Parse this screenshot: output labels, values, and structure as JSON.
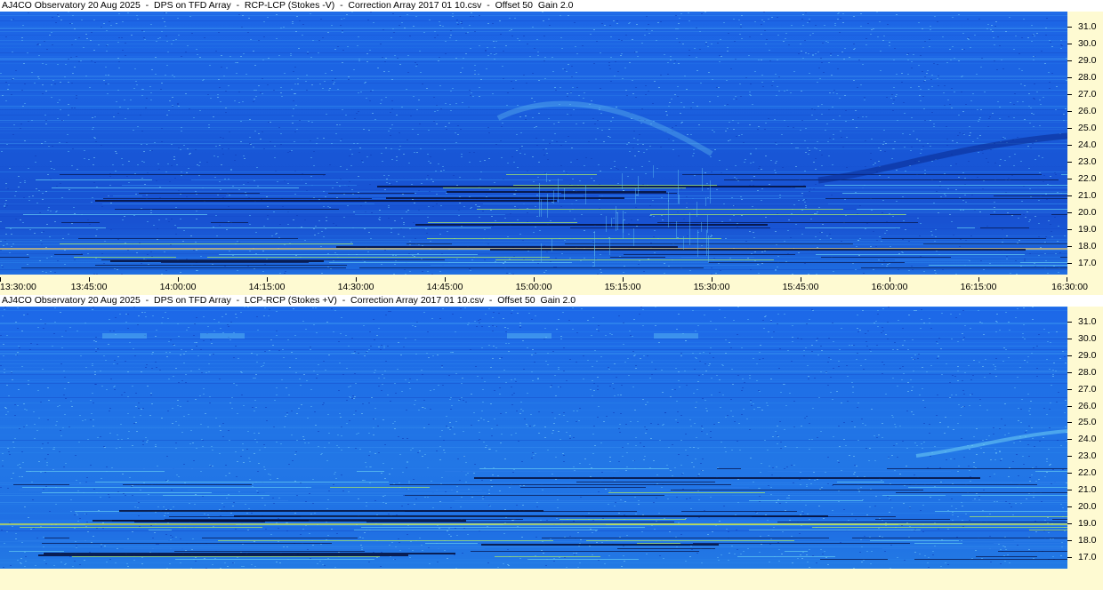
{
  "panels": [
    {
      "title": "AJ4CO Observatory 20 Aug 2025  -  DPS on TFD Array  -  RCP-LCP (Stokes -V)  -  Correction Array 2017 01 10.csv  -  Offset 50  Gain 2.0"
    },
    {
      "title": "AJ4CO Observatory 20 Aug 2025  -  DPS on TFD Array  -  LCP-RCP (Stokes +V)  -  Correction Array 2017 01 10.csv  -  Offset 50  Gain 2.0"
    }
  ],
  "colors": {
    "background": "#1a5ee0",
    "axis_bg": "#fefad2"
  },
  "chart_data": [
    {
      "type": "heatmap",
      "title": "AJ4CO Observatory 20 Aug 2025  -  DPS on TFD Array  -  RCP-LCP (Stokes -V)  -  Correction Array 2017 01 10.csv  -  Offset 50  Gain 2.0",
      "xlabel": "",
      "ylabel": "",
      "x_ticks": [
        "13:30:00",
        "13:45:00",
        "14:00:00",
        "14:15:00",
        "14:30:00",
        "14:45:00",
        "15:00:00",
        "15:15:00",
        "15:30:00",
        "15:45:00",
        "16:00:00",
        "16:15:00",
        "16:30:00"
      ],
      "y_ticks": [
        "31.0",
        "30.0",
        "29.0",
        "28.0",
        "27.0",
        "26.0",
        "25.0",
        "24.0",
        "23.0",
        "22.0",
        "21.0",
        "20.0",
        "19.0",
        "18.0",
        "17.0"
      ],
      "xlim": [
        "13:30:00",
        "16:30:00"
      ],
      "ylim": [
        16.3,
        31.9
      ],
      "colormap": "blue"
    },
    {
      "type": "heatmap",
      "title": "AJ4CO Observatory 20 Aug 2025  -  DPS on TFD Array  -  LCP-RCP (Stokes +V)  -  Correction Array 2017 01 10.csv  -  Offset 50  Gain 2.0",
      "xlabel": "",
      "ylabel": "",
      "x_ticks": [],
      "y_ticks": [
        "31.0",
        "30.0",
        "29.0",
        "28.0",
        "27.0",
        "26.0",
        "25.0",
        "24.0",
        "23.0",
        "22.0",
        "21.0",
        "20.0",
        "19.0",
        "18.0",
        "17.0"
      ],
      "xlim": [
        "13:30:00",
        "16:30:00"
      ],
      "ylim": [
        16.3,
        31.9
      ],
      "colormap": "blue"
    }
  ]
}
